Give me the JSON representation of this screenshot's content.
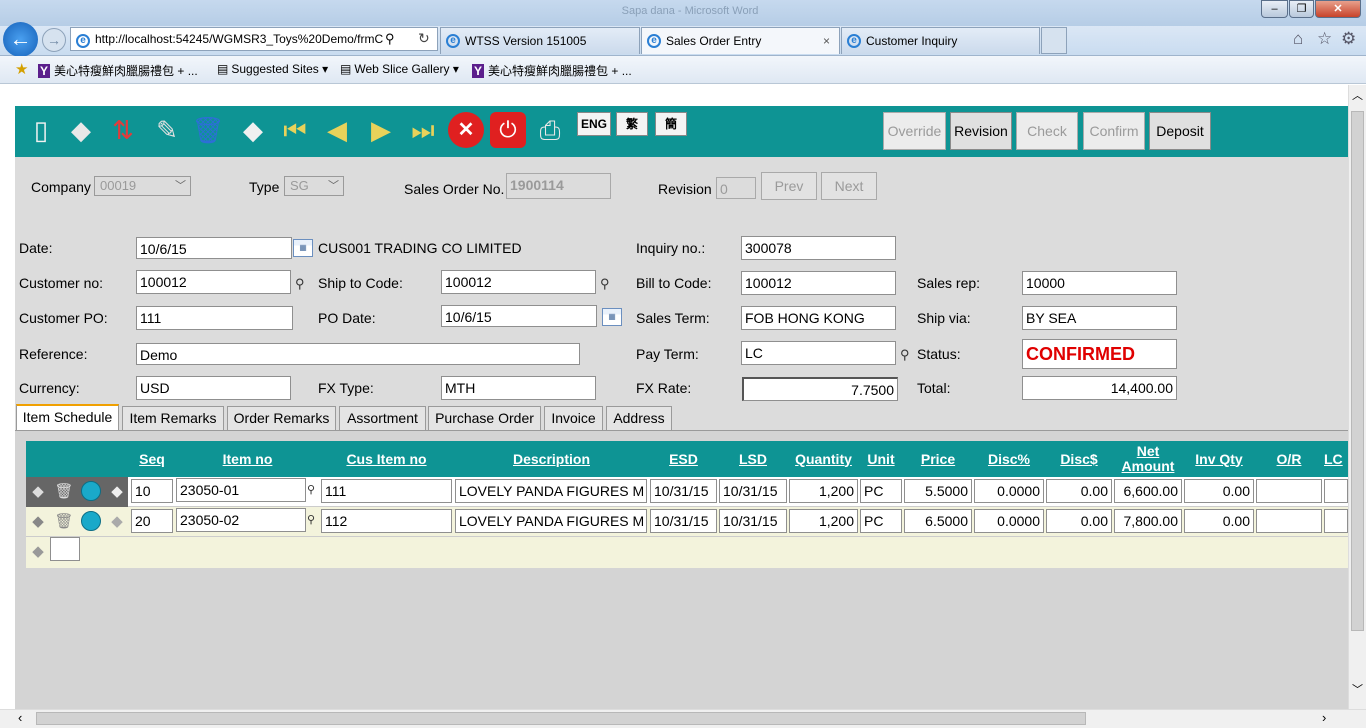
{
  "browser": {
    "window_title": "Sapa dana - Microsoft Word",
    "address": "http://localhost:54245/WGMSR3_Toys%20Demo/frmC",
    "tabs": [
      {
        "label": "WTSS Version 151005"
      },
      {
        "label": "Sales Order Entry",
        "close": "×"
      },
      {
        "label": "Customer Inquiry"
      }
    ],
    "favorites": [
      {
        "label": "美心特瘦鮮肉臘腸禮包 + ..."
      },
      {
        "label": "Suggested Sites ▾"
      },
      {
        "label": "Web Slice Gallery ▾"
      },
      {
        "label": "美心特瘦鮮肉臘腸禮包 + ..."
      }
    ]
  },
  "toolbar": {
    "lang": [
      "ENG",
      "繁",
      "簡"
    ],
    "actions": [
      {
        "label": "Override",
        "enabled": false
      },
      {
        "label": "Revision",
        "enabled": true
      },
      {
        "label": "Check",
        "enabled": false
      },
      {
        "label": "Confirm",
        "enabled": false
      },
      {
        "label": "Deposit",
        "enabled": true
      }
    ]
  },
  "header": {
    "company_label": "Company",
    "company": "00019",
    "type_label": "Type",
    "type": "SG",
    "so_label": "Sales Order No.",
    "so_no": "1900114",
    "revision_label": "Revision",
    "revision": "0",
    "prev_label": "Prev",
    "next_label": "Next"
  },
  "form": {
    "date_label": "Date:",
    "date": "10/6/15",
    "customer_name": "CUS001 TRADING CO LIMITED",
    "inquiry_label": "Inquiry no.:",
    "inquiry": "300078",
    "customer_no_label": "Customer no:",
    "customer_no": "100012",
    "ship_to_label": "Ship to Code:",
    "ship_to": "100012",
    "bill_to_label": "Bill to Code:",
    "bill_to": "100012",
    "sales_rep_label": "Sales rep:",
    "sales_rep": "10000",
    "customer_po_label": "Customer PO:",
    "customer_po": "111",
    "po_date_label": "PO Date:",
    "po_date": "10/6/15",
    "sales_term_label": "Sales Term:",
    "sales_term": "FOB HONG KONG",
    "ship_via_label": "Ship via:",
    "ship_via": "BY SEA",
    "reference_label": "Reference:",
    "reference": "Demo",
    "pay_term_label": "Pay Term:",
    "pay_term": "LC",
    "status_label": "Status:",
    "status": "CONFIRMED",
    "status_color": "#e00000",
    "currency_label": "Currency:",
    "currency": "USD",
    "fx_type_label": "FX Type:",
    "fx_type": "MTH",
    "fx_rate_label": "FX Rate:",
    "fx_rate": "7.7500",
    "total_label": "Total:",
    "total": "14,400.00"
  },
  "tabs": [
    "Item Schedule",
    "Item Remarks",
    "Order Remarks",
    "Assortment",
    "Purchase Order",
    "Invoice",
    "Address"
  ],
  "grid": {
    "columns": [
      "Seq",
      "Item no",
      "Cus Item no",
      "Description",
      "ESD",
      "LSD",
      "Quantity",
      "Unit",
      "Price",
      "Disc%",
      "Disc$",
      "Net Amount",
      "Inv Qty",
      "O/R",
      "LC"
    ],
    "rows": [
      {
        "seq": "10",
        "item_no": "23050-01",
        "cus_item_no": "111",
        "description": "LOVELY PANDA FIGURES M",
        "esd": "10/31/15",
        "lsd": "10/31/15",
        "quantity": "1,200",
        "unit": "PC",
        "price": "5.5000",
        "disc_pct": "0.0000",
        "disc_amt": "0.00",
        "net_amount": "6,600.00",
        "inv_qty": "0.00",
        "or": "",
        "lc": ""
      },
      {
        "seq": "20",
        "item_no": "23050-02",
        "cus_item_no": "112",
        "description": "LOVELY PANDA FIGURES M",
        "esd": "10/31/15",
        "lsd": "10/31/15",
        "quantity": "1,200",
        "unit": "PC",
        "price": "6.5000",
        "disc_pct": "0.0000",
        "disc_amt": "0.00",
        "net_amount": "7,800.00",
        "inv_qty": "0.00",
        "or": "",
        "lc": ""
      }
    ]
  },
  "colors": {
    "toolbar": "#0e9494",
    "form_bg": "#dcdcdc"
  }
}
